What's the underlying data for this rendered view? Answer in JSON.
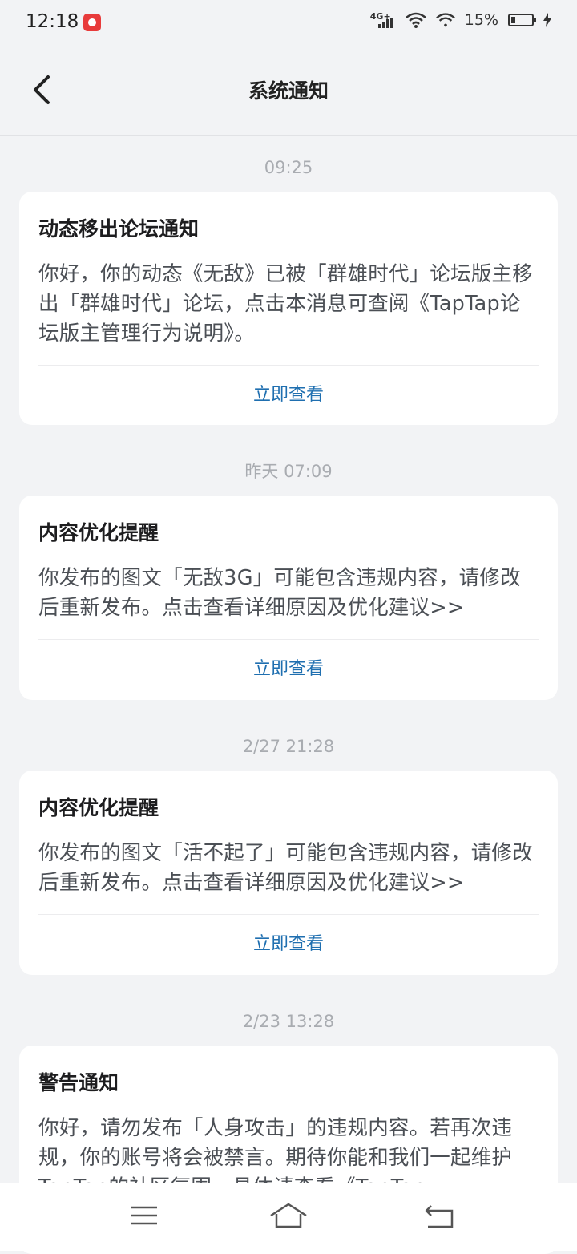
{
  "status_bar": {
    "time": "12:18",
    "network": "4G+",
    "battery": "15%"
  },
  "header": {
    "title": "系统通知"
  },
  "notifications": [
    {
      "time": "09:25",
      "title": "动态移出论坛通知",
      "body": "你好，你的动态《无敌》已被「群雄时代」论坛版主移出「群雄时代」论坛，点击本消息可查阅《TapTap论坛版主管理行为说明》。",
      "action": "立即查看"
    },
    {
      "time": "昨天  07:09",
      "title": "内容优化提醒",
      "body": "你发布的图文「无敌3G」可能包含违规内容，请修改后重新发布。点击查看详细原因及优化建议>>",
      "action": "立即查看"
    },
    {
      "time": "2/27  21:28",
      "title": "内容优化提醒",
      "body": "你发布的图文「活不起了」可能包含违规内容，请修改后重新发布。点击查看详细原因及优化建议>>",
      "action": "立即查看"
    },
    {
      "time": "2/23  13:28",
      "title": "警告通知",
      "body": "你好，请勿发布「人身攻击」的违规内容。若再次违规，你的账号将会被禁言。期待你能和我们一起维护TapTap的社区氛围，具体请查看《TapTap"
    }
  ],
  "icons": {
    "back": "chevron-left-icon",
    "menu": "menu-icon",
    "home": "home-icon",
    "return": "return-icon"
  }
}
